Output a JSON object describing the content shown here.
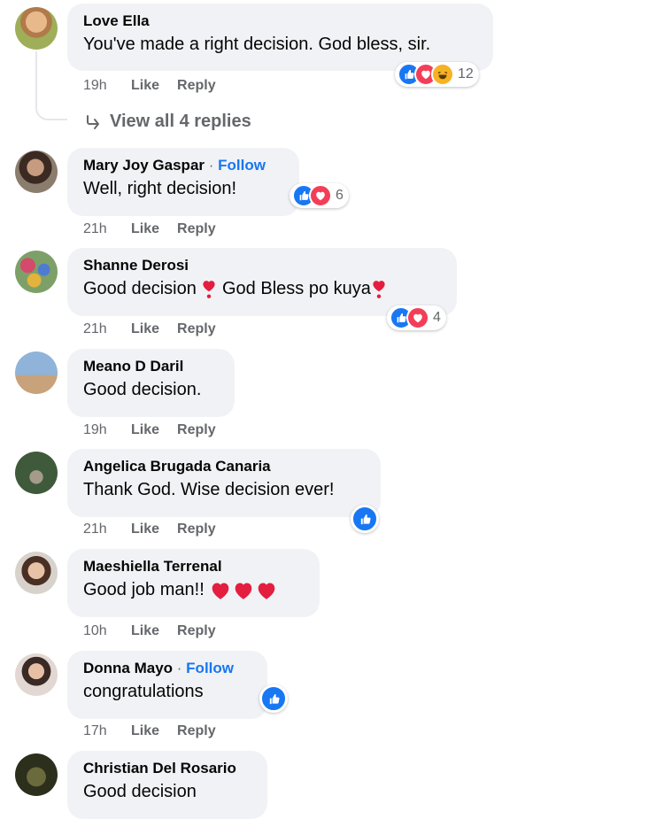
{
  "action_labels": {
    "like": "Like",
    "reply": "Reply"
  },
  "view_replies": "View all 4 replies",
  "colors": {
    "bubble": "#f0f2f5",
    "meta": "#65676b",
    "link": "#1877f2",
    "like": "#1877f2",
    "love": "#f33e58",
    "haha": "#f7b125"
  },
  "comments": [
    {
      "author": "Love Ella",
      "follow": "",
      "text": "You've made a right decision. God bless, sir.",
      "time": "19h",
      "reaction_count": "12",
      "reactions": [
        "like-icon",
        "love-icon",
        "haha-icon"
      ]
    },
    {
      "author": "Mary Joy Gaspar",
      "follow": "Follow",
      "text": "Well, right decision!",
      "time": "21h",
      "reaction_count": "6",
      "reactions": [
        "like-icon",
        "love-icon"
      ]
    },
    {
      "author": "Shanne Derosi",
      "follow": "",
      "text": "Good decision",
      "text_2": "God Bless po kuya",
      "time": "21h",
      "reaction_count": "4",
      "reactions": [
        "like-icon",
        "love-icon"
      ]
    },
    {
      "author": "Meano D Daril",
      "follow": "",
      "text": "Good decision.",
      "time": "19h"
    },
    {
      "author": "Angelica Brugada Canaria",
      "follow": "",
      "text": "Thank God. Wise decision ever!",
      "time": "21h",
      "reactions": [
        "like-icon"
      ]
    },
    {
      "author": "Maeshiella Terrenal",
      "follow": "",
      "text": "Good job man!!",
      "time": "10h",
      "emoji": [
        "heart-emoji",
        "heart-emoji",
        "heart-emoji"
      ]
    },
    {
      "author": "Donna Mayo",
      "follow": "Follow",
      "text": "congratulations",
      "time": "17h",
      "reactions": [
        "like-icon"
      ]
    },
    {
      "author": "Christian Del Rosario",
      "follow": "",
      "text": "Good decision"
    }
  ]
}
